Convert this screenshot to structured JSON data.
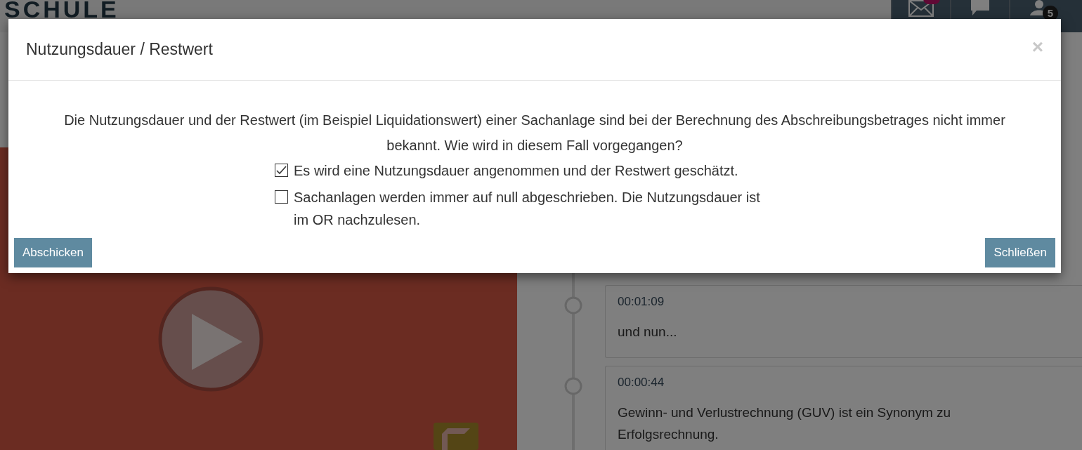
{
  "header": {
    "logo": "SCHULE",
    "nav": [
      {
        "kind": "mail",
        "unread": true
      },
      {
        "kind": "chat"
      },
      {
        "kind": "user",
        "badge": "5"
      }
    ]
  },
  "timeline": [
    {
      "time": "00:01:09",
      "text": "und nun..."
    },
    {
      "time": "00:00:44",
      "text": "Gewinn- und Verlustrechnung (GUV) ist ein Synonym zu Erfolgsrechnung."
    }
  ],
  "dialog": {
    "title": "Nutzungsdauer / Restwert",
    "close": "×",
    "question": "Die Nutzungsdauer und der Restwert (im Beispiel Liquidationswert) einer Sachanlage sind bei der Berechnung des Abschreibungsbetrages nicht immer bekannt. Wie wird in diesem Fall vorgegangen?",
    "options": [
      {
        "label": "Es wird eine Nutzungsdauer angenommen und der Restwert geschätzt.",
        "checked": true
      },
      {
        "label": "Sachanlagen werden immer auf null abgeschrieben. Die Nutzungsdauer ist im OR nachzulesen.",
        "checked": false
      }
    ],
    "buttons": [
      {
        "label": "Abschicken"
      },
      {
        "label": "Schließen"
      }
    ]
  }
}
